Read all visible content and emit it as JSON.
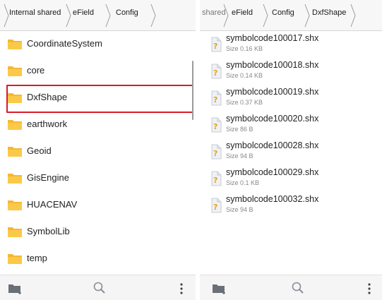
{
  "left": {
    "breadcrumb": [
      "Internal shared",
      "eField",
      "Config"
    ],
    "folders": [
      {
        "name": "CoordinateSystem",
        "selected": false
      },
      {
        "name": "core",
        "selected": false
      },
      {
        "name": "DxfShape",
        "selected": true
      },
      {
        "name": "earthwork",
        "selected": false
      },
      {
        "name": "Geoid",
        "selected": false
      },
      {
        "name": "GisEngine",
        "selected": false
      },
      {
        "name": "HUACENAV",
        "selected": false
      },
      {
        "name": "SymbolLib",
        "selected": false
      },
      {
        "name": "temp",
        "selected": false
      }
    ],
    "toolbar": {
      "icons": [
        "new-folder-icon",
        "search-icon",
        "more-icon"
      ]
    }
  },
  "right": {
    "breadcrumb": [
      "shared",
      "eField",
      "Config",
      "DxfShape"
    ],
    "files": [
      {
        "name": "symbolcode100017.shx",
        "size": "Size 0.16 KB"
      },
      {
        "name": "symbolcode100018.shx",
        "size": "Size 0.14 KB"
      },
      {
        "name": "symbolcode100019.shx",
        "size": "Size 0.37 KB"
      },
      {
        "name": "symbolcode100020.shx",
        "size": "Size 86 B"
      },
      {
        "name": "symbolcode100028.shx",
        "size": "Size 94 B"
      },
      {
        "name": "symbolcode100029.shx",
        "size": "Size 0.1 KB"
      },
      {
        "name": "symbolcode100032.shx",
        "size": "Size 94 B"
      }
    ],
    "toolbar": {
      "icons": [
        "new-folder-icon",
        "search-icon",
        "more-icon"
      ]
    }
  },
  "colors": {
    "selection_border": "#d81b2a",
    "folder": "#f7b731",
    "unknown_file_icon": "#e8a316"
  }
}
